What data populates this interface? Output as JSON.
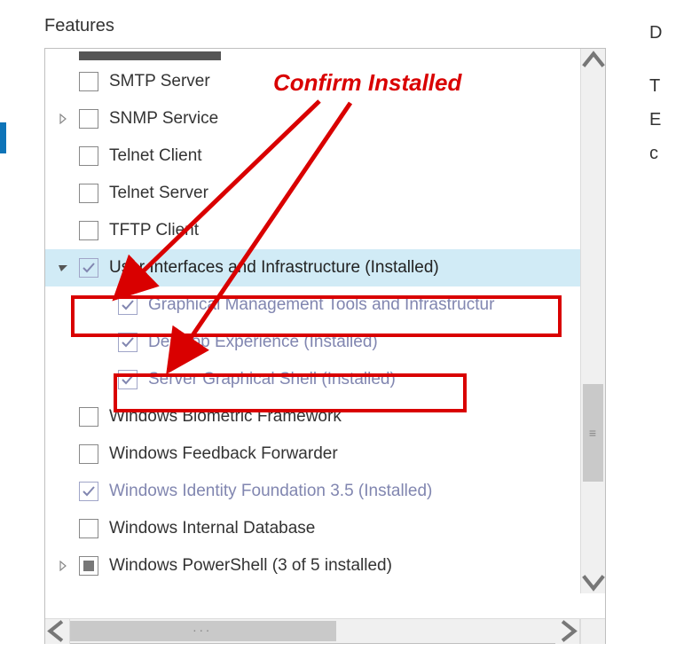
{
  "title": "Features",
  "side_text": {
    "d": "D",
    "t": "T",
    "e": "E",
    "c": "c"
  },
  "annotation": "Confirm Installed",
  "rows": [
    {
      "id": "smtp",
      "indent": 1,
      "expander": "",
      "check": "empty",
      "label": "SMTP Server"
    },
    {
      "id": "snmp",
      "indent": 1,
      "expander": "closed",
      "check": "empty",
      "label": "SNMP Service"
    },
    {
      "id": "telnetc",
      "indent": 1,
      "expander": "",
      "check": "empty",
      "label": "Telnet Client"
    },
    {
      "id": "telnets",
      "indent": 1,
      "expander": "",
      "check": "empty",
      "label": "Telnet Server"
    },
    {
      "id": "tftp",
      "indent": 1,
      "expander": "",
      "check": "empty",
      "label": "TFTP Client"
    },
    {
      "id": "ui",
      "indent": 1,
      "expander": "open",
      "check": "installed",
      "label": "User Interfaces and Infrastructure (Installed)",
      "selected": true
    },
    {
      "id": "gmt",
      "indent": 2,
      "expander": "",
      "check": "installed",
      "label": "Graphical Management Tools and Infrastructur"
    },
    {
      "id": "desk",
      "indent": 2,
      "expander": "",
      "check": "installed",
      "label": "Desktop Experience (Installed)"
    },
    {
      "id": "shell",
      "indent": 2,
      "expander": "",
      "check": "installed",
      "label": "Server Graphical Shell (Installed)"
    },
    {
      "id": "bio",
      "indent": 1,
      "expander": "",
      "check": "empty",
      "label": "Windows Biometric Framework"
    },
    {
      "id": "feed",
      "indent": 1,
      "expander": "",
      "check": "empty",
      "label": "Windows Feedback Forwarder"
    },
    {
      "id": "wif",
      "indent": 1,
      "expander": "",
      "check": "installed",
      "label": "Windows Identity Foundation 3.5 (Installed)"
    },
    {
      "id": "widb",
      "indent": 1,
      "expander": "",
      "check": "empty",
      "label": "Windows Internal Database"
    },
    {
      "id": "wps",
      "indent": 1,
      "expander": "closed",
      "check": "indeterminate",
      "label": "Windows PowerShell (3 of 5 installed)"
    }
  ]
}
